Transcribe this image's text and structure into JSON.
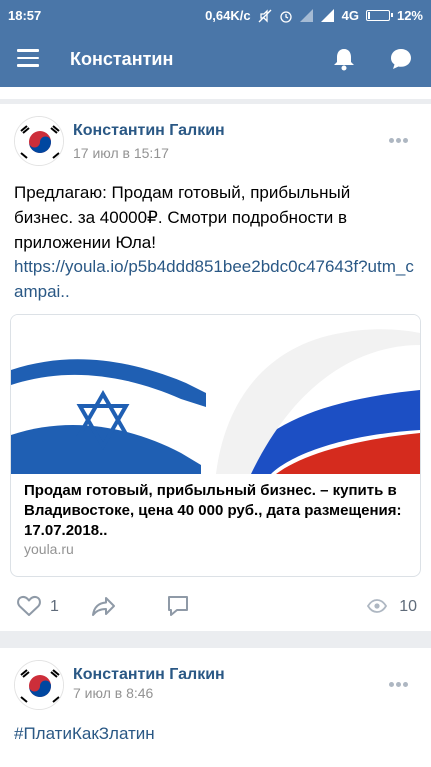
{
  "status_bar": {
    "time": "18:57",
    "speed": "0,64K/c",
    "network": "4G",
    "battery": "12%",
    "battery_level": 0.12
  },
  "app_bar": {
    "title": "Константин"
  },
  "posts": [
    {
      "author": "Константин Галкин",
      "date": "17 июл в 15:17",
      "text": "Предлагаю: Продам готовый, прибыльный бизнес. за 40000₽. Смотри подробности в приложении Юла!",
      "link": "https://youla.io/p5b4ddd851bee2bdc0c47643f?utm_campai..",
      "snippet": {
        "title": "Продам готовый, прибыльный бизнес. – купить в Владивостоке, цена 40 000 руб., дата размещения: 17.07.2018..",
        "domain": "youla.ru"
      },
      "likes": "1",
      "views": "10"
    },
    {
      "author": "Константин Галкин",
      "date": "7 июл в 8:46",
      "hashtag": "#ПлатиКакЗлатин"
    }
  ],
  "colors": {
    "brand": "#4a76a8",
    "link": "#2a5885",
    "muted": "#939393"
  },
  "icons": [
    "menu-icon",
    "bell-icon",
    "message-icon",
    "more-icon",
    "heart-icon",
    "share-icon",
    "comment-icon",
    "eye-icon"
  ]
}
